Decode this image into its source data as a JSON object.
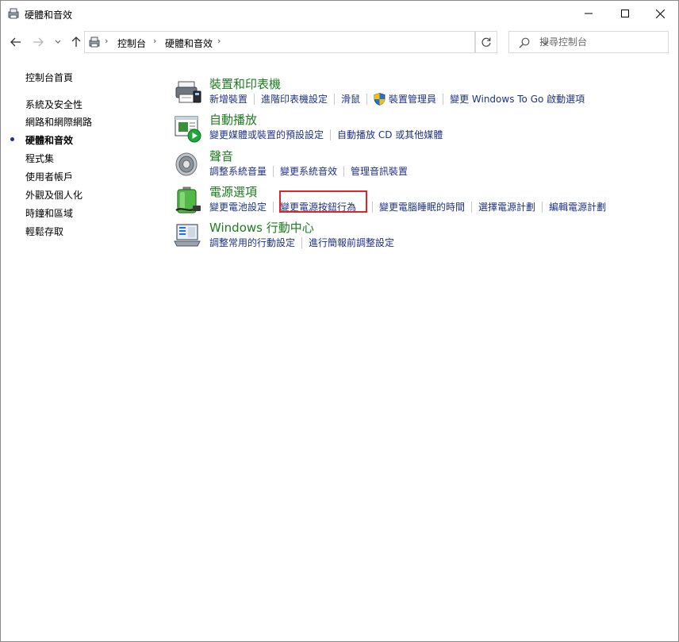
{
  "window": {
    "title": "硬體和音效",
    "icon": "control-panel-icon"
  },
  "navbar": {
    "breadcrumbs": [
      "控制台",
      "硬體和音效"
    ],
    "search_placeholder": "搜尋控制台"
  },
  "sidebar": {
    "items": [
      {
        "label": "控制台首頁",
        "active": false
      },
      {
        "label": "系統及安全性",
        "active": false
      },
      {
        "label": "網路和網際網路",
        "active": false
      },
      {
        "label": "硬體和音效",
        "active": true
      },
      {
        "label": "程式集",
        "active": false
      },
      {
        "label": "使用者帳戶",
        "active": false
      },
      {
        "label": "外觀及個人化",
        "active": false
      },
      {
        "label": "時鐘和區域",
        "active": false
      },
      {
        "label": "輕鬆存取",
        "active": false
      }
    ]
  },
  "categories": [
    {
      "title": "裝置和印表機",
      "icon": "printer-icon",
      "links": [
        "新增裝置",
        "進階印表機設定",
        "滑鼠",
        "裝置管理員",
        "變更 Windows To Go 啟動選項"
      ]
    },
    {
      "title": "自動播放",
      "icon": "autoplay-icon",
      "links": [
        "變更媒體或裝置的預設設定",
        "自動播放 CD 或其他媒體"
      ]
    },
    {
      "title": "聲音",
      "icon": "speaker-icon",
      "links": [
        "調整系統音量",
        "變更系統音效",
        "管理音訊裝置"
      ]
    },
    {
      "title": "電源選項",
      "icon": "battery-icon",
      "links": [
        "變更電池設定",
        "變更電源按鈕行為",
        "變更電腦睡眠的時間",
        "選擇電源計劃",
        "編輯電源計劃"
      ]
    },
    {
      "title": "Windows 行動中心",
      "icon": "mobility-center-icon",
      "links": [
        "調整常用的行動設定",
        "進行簡報前調整設定"
      ]
    }
  ],
  "colors": {
    "category_title": "#1e7b1e",
    "link": "#1e3287",
    "highlight": "#e0252a"
  }
}
